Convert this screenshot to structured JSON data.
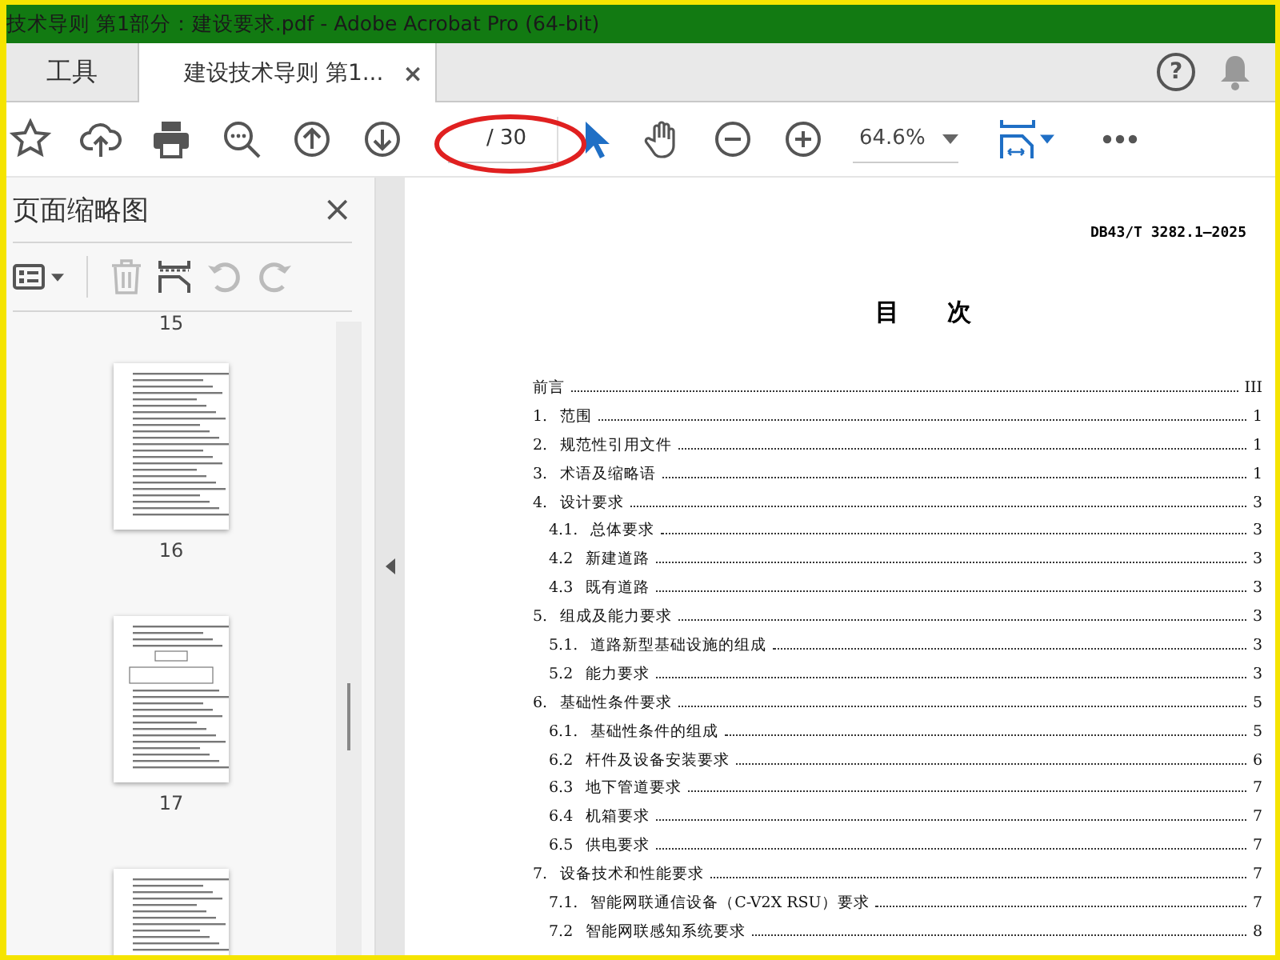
{
  "window": {
    "title": "技术导则 第1部分：建设要求.pdf - Adobe Acrobat Pro (64-bit)"
  },
  "tabs": [
    {
      "label": "工具",
      "selected": false
    },
    {
      "label": "建设技术导则 第1...",
      "selected": true,
      "close": "×"
    }
  ],
  "help": "?",
  "toolbar": {
    "page_total": "/ 30",
    "zoom": "64.6%"
  },
  "sidebar": {
    "title": "页面缩略图",
    "close": "×",
    "top_label": "15",
    "thumbnails": [
      {
        "label": "16",
        "kind": "text"
      },
      {
        "label": "17",
        "kind": "diagram"
      },
      {
        "kind": "text"
      }
    ]
  },
  "document": {
    "header": "DB43/T 3282.1—2025",
    "title": "目　　次",
    "toc": [
      {
        "text": "前言",
        "page": "III"
      },
      {
        "number": "1.",
        "text": "范围",
        "page": "1"
      },
      {
        "number": "2.",
        "text": "规范性引用文件",
        "page": "1"
      },
      {
        "number": "3.",
        "text": "术语及缩略语",
        "page": "1"
      },
      {
        "number": "4.",
        "text": "设计要求",
        "page": "3",
        "children": [
          {
            "number": "4.1.",
            "text": "总体要求",
            "page": "3"
          },
          {
            "number": "4.2",
            "text": "新建道路",
            "page": "3"
          },
          {
            "number": "4.3",
            "text": "既有道路",
            "page": "3"
          }
        ]
      },
      {
        "number": "5.",
        "text": "组成及能力要求",
        "page": "3",
        "children": [
          {
            "number": "5.1.",
            "text": "道路新型基础设施的组成",
            "page": "3"
          },
          {
            "number": "5.2",
            "text": "能力要求",
            "page": "3"
          }
        ]
      },
      {
        "number": "6.",
        "text": "基础性条件要求",
        "page": "5",
        "children": [
          {
            "number": "6.1.",
            "text": "基础性条件的组成",
            "page": "5"
          },
          {
            "number": "6.2",
            "text": "杆件及设备安装要求",
            "page": "6"
          },
          {
            "number": "6.3",
            "text": "地下管道要求",
            "page": "7"
          },
          {
            "number": "6.4",
            "text": "机箱要求",
            "page": "7"
          },
          {
            "number": "6.5",
            "text": "供电要求",
            "page": "7"
          }
        ]
      },
      {
        "number": "7.",
        "text": "设备技术和性能要求",
        "page": "7",
        "children": [
          {
            "number": "7.1.",
            "text": "智能网联通信设备（C-V2X RSU）要求",
            "page": "7"
          },
          {
            "number": "7.2",
            "text": "智能网联感知系统要求",
            "page": "8"
          }
        ]
      }
    ]
  }
}
